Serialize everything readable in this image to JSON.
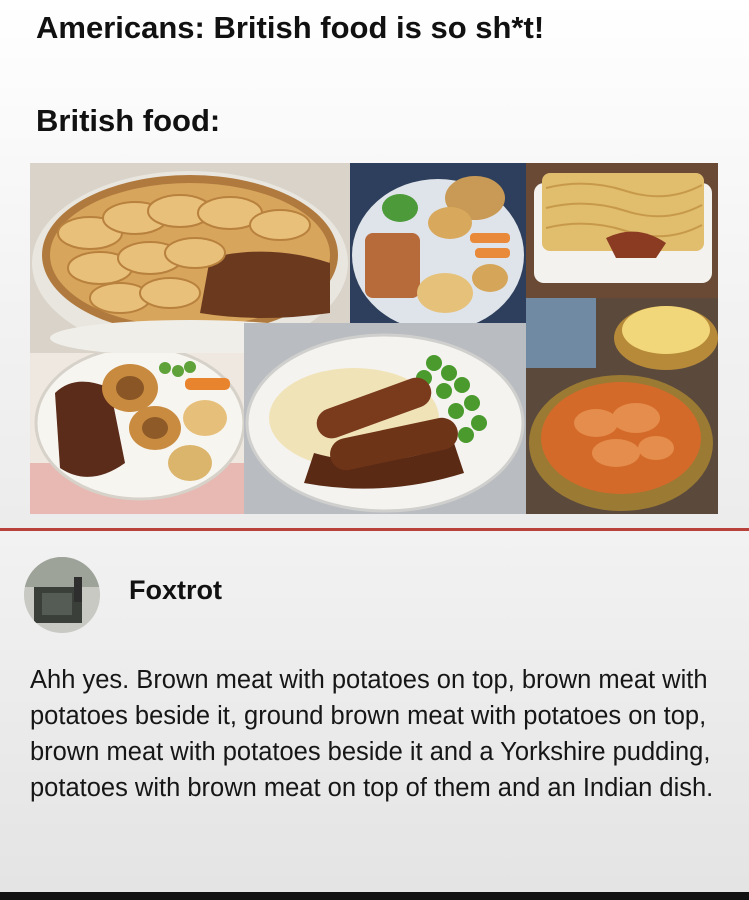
{
  "meme": {
    "line1": "Americans: British food is so sh*t!",
    "line2": "British food:"
  },
  "collage": {
    "photos": [
      {
        "icon": "meat-potato-pie-icon"
      },
      {
        "icon": "roast-dinner-icon"
      },
      {
        "icon": "shepherds-pie-icon"
      },
      {
        "icon": "roast-beef-yorkshire-pudding-icon"
      },
      {
        "icon": "bangers-and-mash-icon"
      },
      {
        "icon": "indian-curry-icon"
      }
    ]
  },
  "comment": {
    "username": "Foxtrot",
    "text": "Ahh yes. Brown meat with potatoes on top, brown meat with potatoes beside it, ground brown meat with potatoes on top, brown meat with potatoes beside it and a Yorkshire pudding, potatoes with brown meat on top of them and an Indian dish."
  },
  "colors": {
    "divider": "#b8423b",
    "text": "#111111"
  }
}
